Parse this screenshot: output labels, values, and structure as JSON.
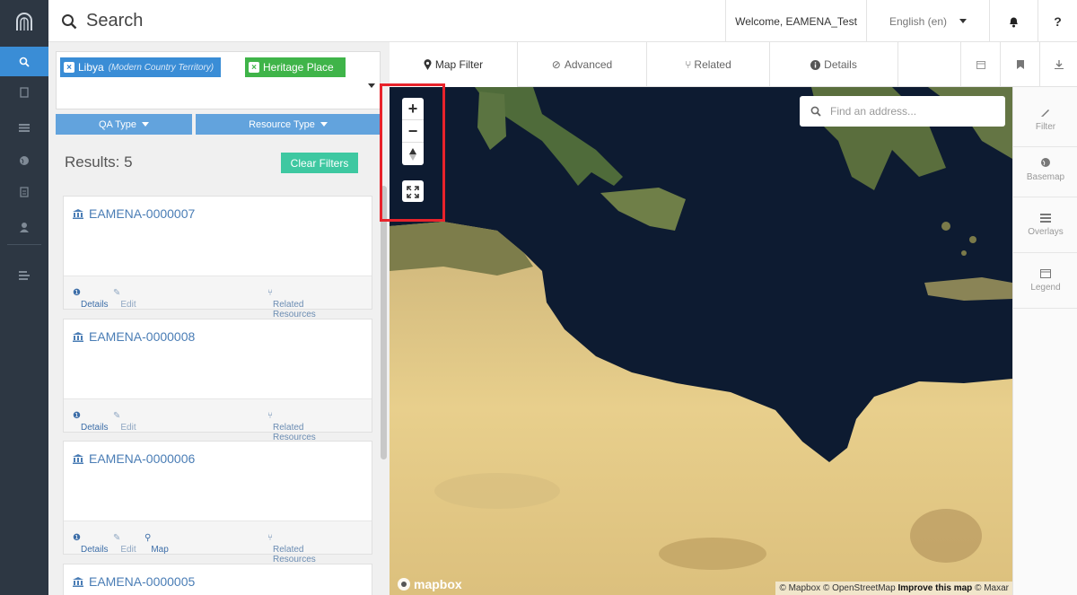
{
  "topbar": {
    "search_label": "Search",
    "welcome": "Welcome, EAMENA_Test",
    "language": "English (en)",
    "help": "?"
  },
  "filters": {
    "tags": [
      {
        "label": "Libya",
        "sub": "(Modern Country Territory)"
      },
      {
        "label": "Heritage Place"
      }
    ],
    "qa_type": "QA Type",
    "resource_type": "Resource Type"
  },
  "results": {
    "label": "Results: 5",
    "clear_label": "Clear Filters",
    "cards": [
      {
        "id": "EAMENA-0000007",
        "details": "Details",
        "edit": "Edit",
        "related": "Related Resources"
      },
      {
        "id": "EAMENA-0000008",
        "details": "Details",
        "edit": "Edit",
        "related": "Related Resources"
      },
      {
        "id": "EAMENA-0000006",
        "details": "Details",
        "edit": "Edit",
        "map": "Map",
        "related": "Related Resources"
      },
      {
        "id": "EAMENA-0000005"
      }
    ]
  },
  "map_tabs": [
    "Map Filter",
    "Advanced",
    "Related",
    "Details"
  ],
  "map": {
    "address_placeholder": "Find an address...",
    "logo": "mapbox",
    "attribution_pre": "© Mapbox © OpenStreetMap",
    "attribution_bold": "Improve this map",
    "attribution_post": "© Maxar"
  },
  "right_panel": [
    "Filter",
    "Basemap",
    "Overlays",
    "Legend"
  ],
  "colors": {
    "rail": "#2d3743",
    "accent": "#3a8dd6",
    "tag_green": "#3fb449",
    "clear_button": "#3ec8a1",
    "highlight": "#e8232b"
  }
}
